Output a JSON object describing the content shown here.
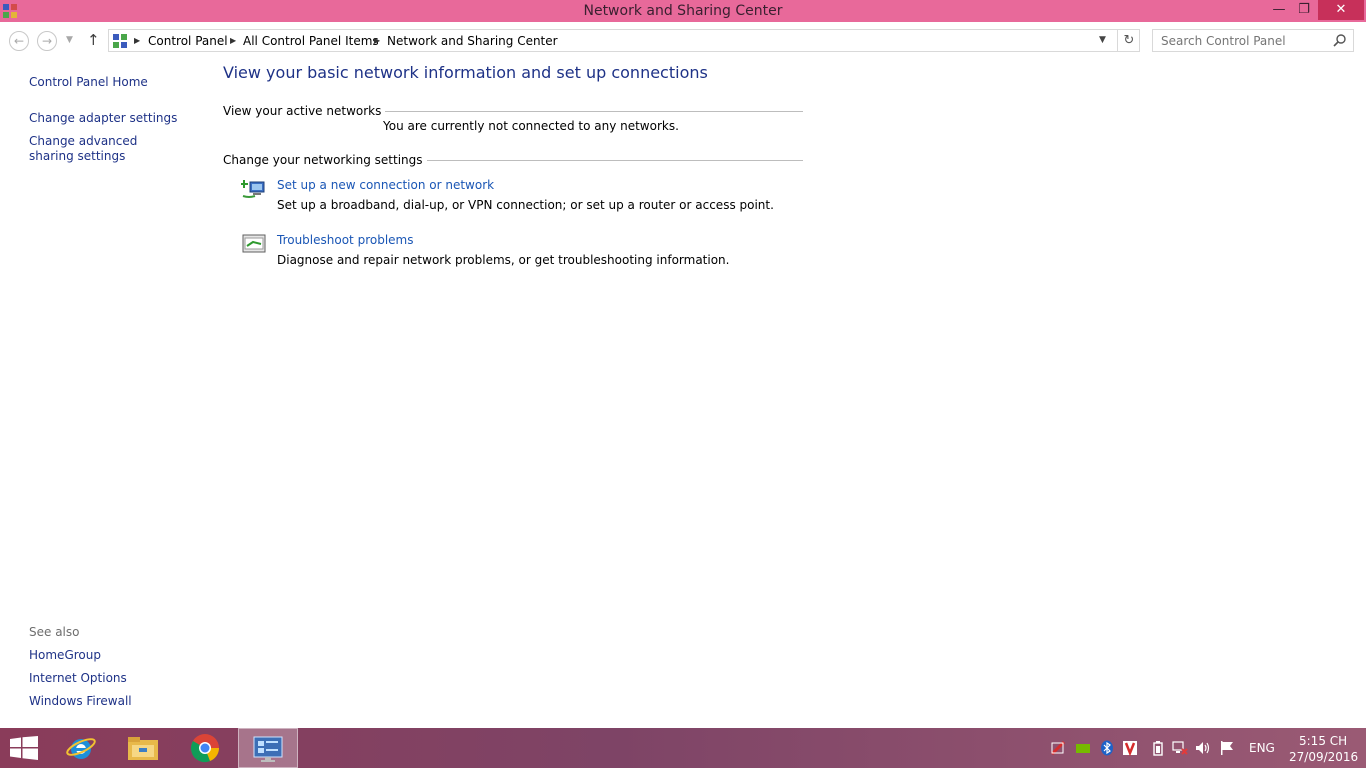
{
  "window": {
    "title": "Network and Sharing Center",
    "controls": {
      "minimize": "minimize-icon",
      "restore": "restore-icon",
      "close": "close-icon"
    }
  },
  "nav": {
    "back": "back-arrow-icon",
    "forward": "forward-arrow-icon",
    "recent": "chevron-down-icon",
    "up": "up-arrow-icon",
    "breadcrumb": [
      "Control Panel",
      "All Control Panel Items",
      "Network and Sharing Center"
    ],
    "search_placeholder": "Search Control Panel"
  },
  "left_pane": {
    "links": [
      "Control Panel Home",
      "Change adapter settings",
      "Change advanced sharing settings"
    ],
    "see_also_label": "See also",
    "see_also": [
      "HomeGroup",
      "Internet Options",
      "Windows Firewall"
    ]
  },
  "main": {
    "heading": "View your basic network information and set up connections",
    "active_networks_label": "View your active networks",
    "active_networks_message": "You are currently not connected to any networks.",
    "settings_label": "Change your networking settings",
    "tasks": [
      {
        "link": "Set up a new connection or network",
        "description": "Set up a broadband, dial-up, or VPN connection; or set up a router or access point.",
        "icon": "new-connection-icon"
      },
      {
        "link": "Troubleshoot problems",
        "description": "Diagnose and repair network problems, or get troubleshooting information.",
        "icon": "troubleshoot-icon"
      }
    ]
  },
  "taskbar": {
    "apps": [
      "start-icon",
      "internet-explorer-icon",
      "file-explorer-icon",
      "chrome-icon",
      "control-panel-icon"
    ],
    "tray": {
      "language": "ENG",
      "time": "5:15 CH",
      "date": "27/09/2016"
    }
  },
  "colors": {
    "title_bar": "#e8699a",
    "close_button": "#c7305a",
    "link": "#1e3287",
    "task_link": "#1a56b5",
    "taskbar": "#8a3c5a"
  }
}
